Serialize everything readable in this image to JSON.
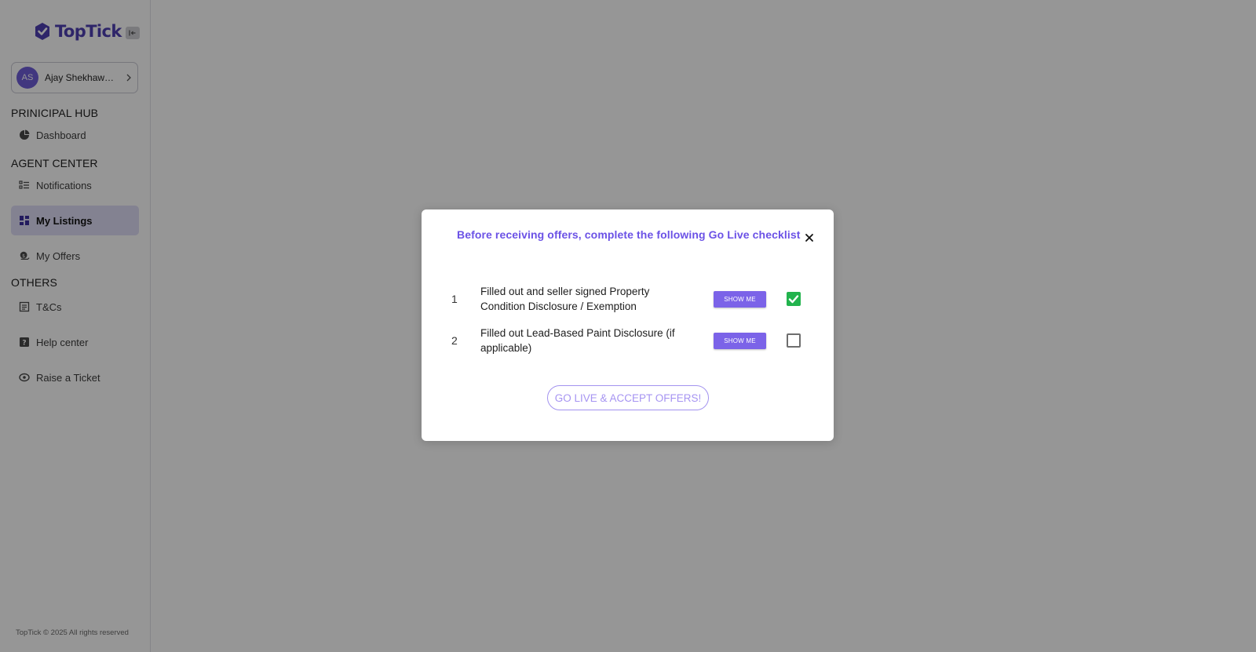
{
  "brand": {
    "name": "TopTick",
    "icon": "checkmark-logo-icon"
  },
  "user": {
    "initials": "AS",
    "name": "Ajay Shekhawat -..."
  },
  "sidebar": {
    "sections": [
      {
        "heading": "PRINICIPAL HUB",
        "items": [
          {
            "label": "Dashboard",
            "icon": "pie-chart-icon"
          }
        ]
      },
      {
        "heading": "AGENT CENTER",
        "items": [
          {
            "label": "Notifications",
            "icon": "list-icon"
          },
          {
            "label": "My Listings",
            "icon": "grid-icon",
            "active": true
          },
          {
            "label": "My Offers",
            "icon": "offers-icon"
          }
        ]
      },
      {
        "heading": "OTHERS",
        "items": [
          {
            "label": "T&Cs",
            "icon": "document-icon"
          },
          {
            "label": "Help center",
            "icon": "question-icon"
          },
          {
            "label": "Raise a Ticket",
            "icon": "ticket-icon"
          }
        ]
      }
    ],
    "footer": "TopTick © 2025 All rights reserved"
  },
  "modal": {
    "title": "Before receiving offers, complete the following Go Live checklist",
    "items": [
      {
        "number": "1",
        "text": "Filled out and seller signed Property Condition Disclosure / Exemption",
        "button": "SHOW ME",
        "checked": true
      },
      {
        "number": "2",
        "text": "Filled out Lead-Based Paint Disclosure (if applicable)",
        "button": "SHOW ME",
        "checked": false
      }
    ],
    "cta": "GO LIVE & ACCEPT OFFERS!"
  },
  "colors": {
    "brand": "#4f3fb3",
    "accent": "#7b63e8",
    "success": "#22b34d"
  }
}
